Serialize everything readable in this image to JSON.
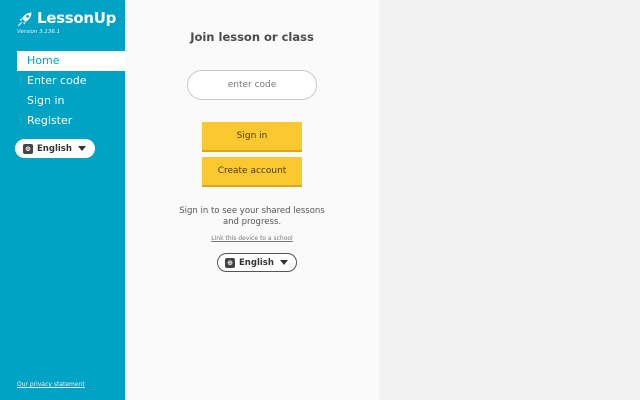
{
  "brand": {
    "name": "LessonUp",
    "version": "Version 3.136.1",
    "logo_icon": "rocket-icon"
  },
  "sidebar": {
    "nav": [
      {
        "label": "Home",
        "active": true
      },
      {
        "label": "Enter code",
        "active": false
      },
      {
        "label": "Sign in",
        "active": false
      },
      {
        "label": "Register",
        "active": false
      }
    ],
    "language": "English",
    "privacy_link": "Our privacy statement"
  },
  "main": {
    "title": "Join lesson or class",
    "code_placeholder": "enter code",
    "signin_label": "Sign in",
    "create_label": "Create account",
    "info_line1": "Sign in to see your shared lessons",
    "info_line2": "and progress.",
    "link_device": "Link this device to a school",
    "language": "English"
  },
  "colors": {
    "sidebar_bg": "#00a3c4",
    "button_yellow": "#fbc92f",
    "main_bg": "#fafafa",
    "page_bg": "#f2f2f2"
  }
}
